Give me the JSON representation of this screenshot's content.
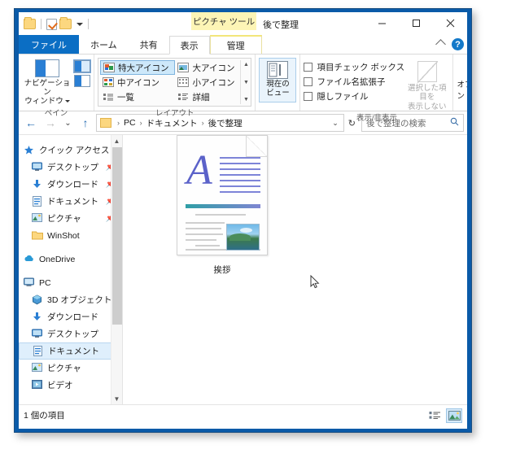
{
  "window": {
    "title": "後で整理",
    "contextual_tool_label": "ピクチャ ツール",
    "caption": {
      "minimize": "minimize-icon",
      "maximize": "maximize-icon",
      "close": "close-icon"
    },
    "quick_access": [
      {
        "name": "folder-icon",
        "label": ""
      },
      {
        "name": "properties-icon",
        "label": ""
      },
      {
        "name": "new-folder-icon",
        "label": ""
      },
      {
        "name": "customize-caret-icon",
        "label": ""
      }
    ]
  },
  "tabs": [
    {
      "id": "file",
      "label": "ファイル"
    },
    {
      "id": "home",
      "label": "ホーム"
    },
    {
      "id": "share",
      "label": "共有"
    },
    {
      "id": "view",
      "label": "表示"
    },
    {
      "id": "manage",
      "label": "管理"
    }
  ],
  "ribbon_right": {
    "collapse": "chevron-up-icon",
    "help": "?"
  },
  "ribbon": {
    "panes_group": {
      "label": "ペイン",
      "navigation_button": "ナビゲーション\nウィンドウ",
      "navigation_line1": "ナビゲーション",
      "navigation_line2": "ウィンドウ"
    },
    "layout_group": {
      "label": "レイアウト",
      "items": [
        {
          "label": "特大アイコン",
          "selected": true
        },
        {
          "label": "大アイコン",
          "selected": false
        },
        {
          "label": "中アイコン",
          "selected": false
        },
        {
          "label": "小アイコン",
          "selected": false
        },
        {
          "label": "一覧",
          "selected": false
        },
        {
          "label": "詳細",
          "selected": false
        }
      ]
    },
    "current_view_group": {
      "label": "",
      "button_line1": "現在の",
      "button_line2": "ビュー"
    },
    "show_hide_group": {
      "label": "表示/非表示",
      "checkboxes": [
        {
          "label": "項目チェック ボックス",
          "checked": false
        },
        {
          "label": "ファイル名拡張子",
          "checked": false
        },
        {
          "label": "隠しファイル",
          "checked": false
        }
      ],
      "hide_selected_line1": "選択した項目を",
      "hide_selected_line2": "表示しない"
    },
    "options_group": {
      "label": "",
      "button": "オプション"
    }
  },
  "address": {
    "back": "←",
    "forward": "→",
    "history": "⌄",
    "up": "↑",
    "crumbs": [
      "PC",
      "ドキュメント",
      "後で整理"
    ],
    "dropdown": "⌄",
    "refresh": "↻",
    "search_placeholder": "後で整理の検索",
    "search_value": ""
  },
  "nav_pane": {
    "groups": [
      {
        "header": {
          "label": "クイック アクセス",
          "icon": "star-icon"
        },
        "items": [
          {
            "label": "デスクトップ",
            "icon": "desktop-icon",
            "pinned": true
          },
          {
            "label": "ダウンロード",
            "icon": "download-icon",
            "pinned": true
          },
          {
            "label": "ドキュメント",
            "icon": "documents-icon",
            "pinned": true
          },
          {
            "label": "ピクチャ",
            "icon": "pictures-icon",
            "pinned": true
          },
          {
            "label": "WinShot",
            "icon": "folder-icon",
            "pinned": false
          }
        ]
      },
      {
        "header": {
          "label": "OneDrive",
          "icon": "onedrive-icon"
        },
        "items": []
      },
      {
        "header": {
          "label": "PC",
          "icon": "pc-icon"
        },
        "items": [
          {
            "label": "3D オブジェクト",
            "icon": "3d-objects-icon",
            "selected": false
          },
          {
            "label": "ダウンロード",
            "icon": "download-icon",
            "selected": false
          },
          {
            "label": "デスクトップ",
            "icon": "desktop-icon",
            "selected": false
          },
          {
            "label": "ドキュメント",
            "icon": "documents-icon",
            "selected": true
          },
          {
            "label": "ピクチャ",
            "icon": "pictures-icon",
            "selected": false
          },
          {
            "label": "ビデオ",
            "icon": "videos-icon",
            "selected": false
          }
        ]
      }
    ]
  },
  "content": {
    "files": [
      {
        "name": "挨拶",
        "icon": "word-document-thumbnail"
      }
    ]
  },
  "status": {
    "item_count_text": "1 個の項目",
    "view_buttons": [
      {
        "name": "details-view-button",
        "selected": false
      },
      {
        "name": "large-icons-view-button",
        "selected": true
      }
    ]
  },
  "colors": {
    "window_border": "#0a5aa8",
    "file_tab": "#0b6ec4",
    "contextual_band": "#fdf5b6",
    "selection": "#dfeffc",
    "accent": "#2a7fd4"
  }
}
